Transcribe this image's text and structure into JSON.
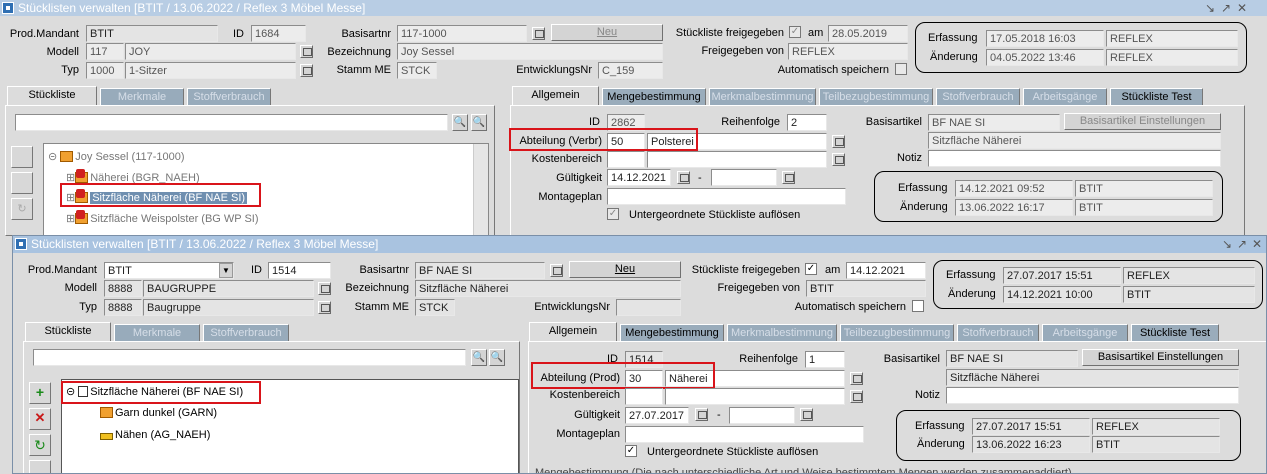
{
  "w1": {
    "title": "Stücklisten verwalten  [BTIT / 13.06.2022 / Reflex 3 Möbel Messe]",
    "mandant_label": "Prod.Mandant",
    "mandant": "BTIT",
    "id_label": "ID",
    "id": "1684",
    "modell_label": "Modell",
    "modell_code": "117",
    "modell_name": "JOY",
    "typ_label": "Typ",
    "typ_code": "1000",
    "typ_name": "1-Sitzer",
    "basis_label": "Basisartnr",
    "basis": "117-1000",
    "neu": "Neu",
    "bez_label": "Bezeichnung",
    "bez": "Joy Sessel",
    "stamm_label": "Stamm ME",
    "stamm": "STCK",
    "entw_label": "EntwicklungsNr",
    "entw": "C_159",
    "frei_label": "Stückliste freigegeben",
    "am_label": "am",
    "am": "28.05.2019",
    "freivon_label": "Freigegeben von",
    "freivon": "REFLEX",
    "auto_label": "Automatisch speichern",
    "erf_label": "Erfassung",
    "erf_date": "17.05.2018 16:03",
    "erf_user": "REFLEX",
    "aend_label": "Änderung",
    "aend_date": "04.05.2022 13:46",
    "aend_user": "REFLEX",
    "ltabs": [
      "Stückliste",
      "Merkmale",
      "Stoffverbrauch"
    ],
    "tree": [
      "Joy Sessel (117-1000)",
      "Näherei (BGR_NAEH)",
      "Sitzfläche Näherei (BF NAE SI)",
      "Sitzfläche Weispolster (BG WP SI)"
    ],
    "rtabs": [
      "Allgemein",
      "Mengebestimmung",
      "Merkmalbestimmung",
      "Teilbezugbestimmung",
      "Stoffverbrauch",
      "Arbeitsgänge",
      "Stückliste Test"
    ],
    "r_id": "2862",
    "reihen_label": "Reihenfolge",
    "reihen": "2",
    "abt_label": "Abteilung (Verbr)",
    "abt_code": "50",
    "abt_name": "Polsterei",
    "kosten_label": "Kostenbereich",
    "gueltig_label": "Gültigkeit",
    "gueltig": "14.12.2021",
    "dash": "-",
    "monta_label": "Montageplan",
    "unter_label": "Untergeordnete Stückliste auflösen",
    "basart_label": "Basisartikel",
    "basart": "BF NAE SI",
    "basart_btn": "Basisartikel Einstellungen",
    "basart_name": "Sitzfläche Näherei",
    "notiz_label": "Notiz",
    "r_erf_date": "14.12.2021 09:52",
    "r_erf_user": "BTIT",
    "r_aend_date": "13.06.2022 16:17",
    "r_aend_user": "BTIT"
  },
  "w2": {
    "title": "Stücklisten verwalten  [BTIT / 13.06.2022 / Reflex 3 Möbel Messe]",
    "mandant_label": "Prod.Mandant",
    "mandant": "BTIT",
    "id_label": "ID",
    "id": "1514",
    "modell_label": "Modell",
    "modell_code": "8888",
    "modell_name": "BAUGRUPPE",
    "typ_label": "Typ",
    "typ_code": "8888",
    "typ_name": "Baugruppe",
    "basis_label": "Basisartnr",
    "basis": "BF NAE SI",
    "neu": "Neu",
    "bez_label": "Bezeichnung",
    "bez": "Sitzfläche Näherei",
    "stamm_label": "Stamm ME",
    "stamm": "STCK",
    "entw_label": "EntwicklungsNr",
    "entw": "",
    "frei_label": "Stückliste freigegeben",
    "am_label": "am",
    "am": "14.12.2021",
    "freivon_label": "Freigegeben von",
    "freivon": "BTIT",
    "auto_label": "Automatisch speichern",
    "erf_label": "Erfassung",
    "erf_date": "27.07.2017 15:51",
    "erf_user": "REFLEX",
    "aend_label": "Änderung",
    "aend_date": "14.12.2021 10:00",
    "aend_user": "BTIT",
    "ltabs": [
      "Stückliste",
      "Merkmale",
      "Stoffverbrauch"
    ],
    "tree": [
      "Sitzfläche Näherei (BF NAE SI)",
      "Garn dunkel (GARN)",
      "Nähen (AG_NAEH)"
    ],
    "rtabs": [
      "Allgemein",
      "Mengebestimmung",
      "Merkmalbestimmung",
      "Teilbezugbestimmung",
      "Stoffverbrauch",
      "Arbeitsgänge",
      "Stückliste Test"
    ],
    "r_id": "1514",
    "reihen_label": "Reihenfolge",
    "reihen": "1",
    "abt_label": "Abteilung (Prod)",
    "abt_code": "30",
    "abt_name": "Näherei",
    "kosten_label": "Kostenbereich",
    "gueltig_label": "Gültigkeit",
    "gueltig": "27.07.2017",
    "dash": "-",
    "monta_label": "Montageplan",
    "unter_label": "Untergeordnete Stückliste auflösen",
    "basart_label": "Basisartikel",
    "basart": "BF NAE SI",
    "basart_btn": "Basisartikel Einstellungen",
    "basart_name": "Sitzfläche Näherei",
    "notiz_label": "Notiz",
    "r_erf_date": "27.07.2017 15:51",
    "r_erf_user": "REFLEX",
    "r_aend_date": "13.06.2022 16:23",
    "r_aend_user": "BTIT",
    "footer": "Mengebestimmung    (Die nach unterschiedliche Art und Weise bestimmtem Mengen werden zusammenaddiert)"
  }
}
